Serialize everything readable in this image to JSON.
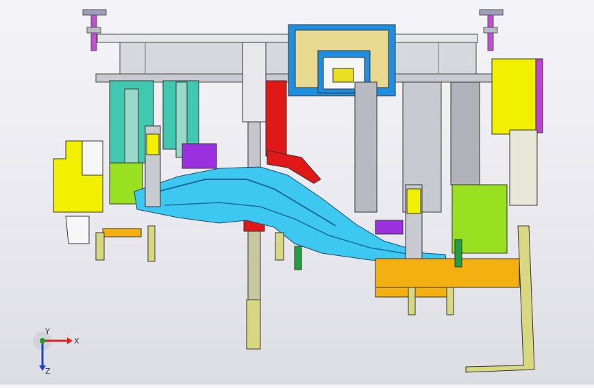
{
  "viewport": {
    "background_top": "#f4f4f8",
    "background_bottom": "#dcdce3"
  },
  "triad": {
    "x_label": "X",
    "y_label": "Y",
    "z_label": "Z",
    "x_color": "#e02020",
    "y_color": "#20a020",
    "z_color": "#2040d0",
    "icon": "coordinate-triad-icon"
  },
  "colors": {
    "frame_gray": "#d0d2d8",
    "cyan_part": "#3cc8f0",
    "teal_bracket": "#40c8b0",
    "yellow_block": "#f0f000",
    "lime_block": "#98e020",
    "blue_box": "#1e8ee0",
    "red_column": "#e01818",
    "purple_clamp": "#9a30e0",
    "orange_base": "#f4b010",
    "khaki_arm": "#d8d880",
    "magenta_pin": "#c040d0"
  }
}
